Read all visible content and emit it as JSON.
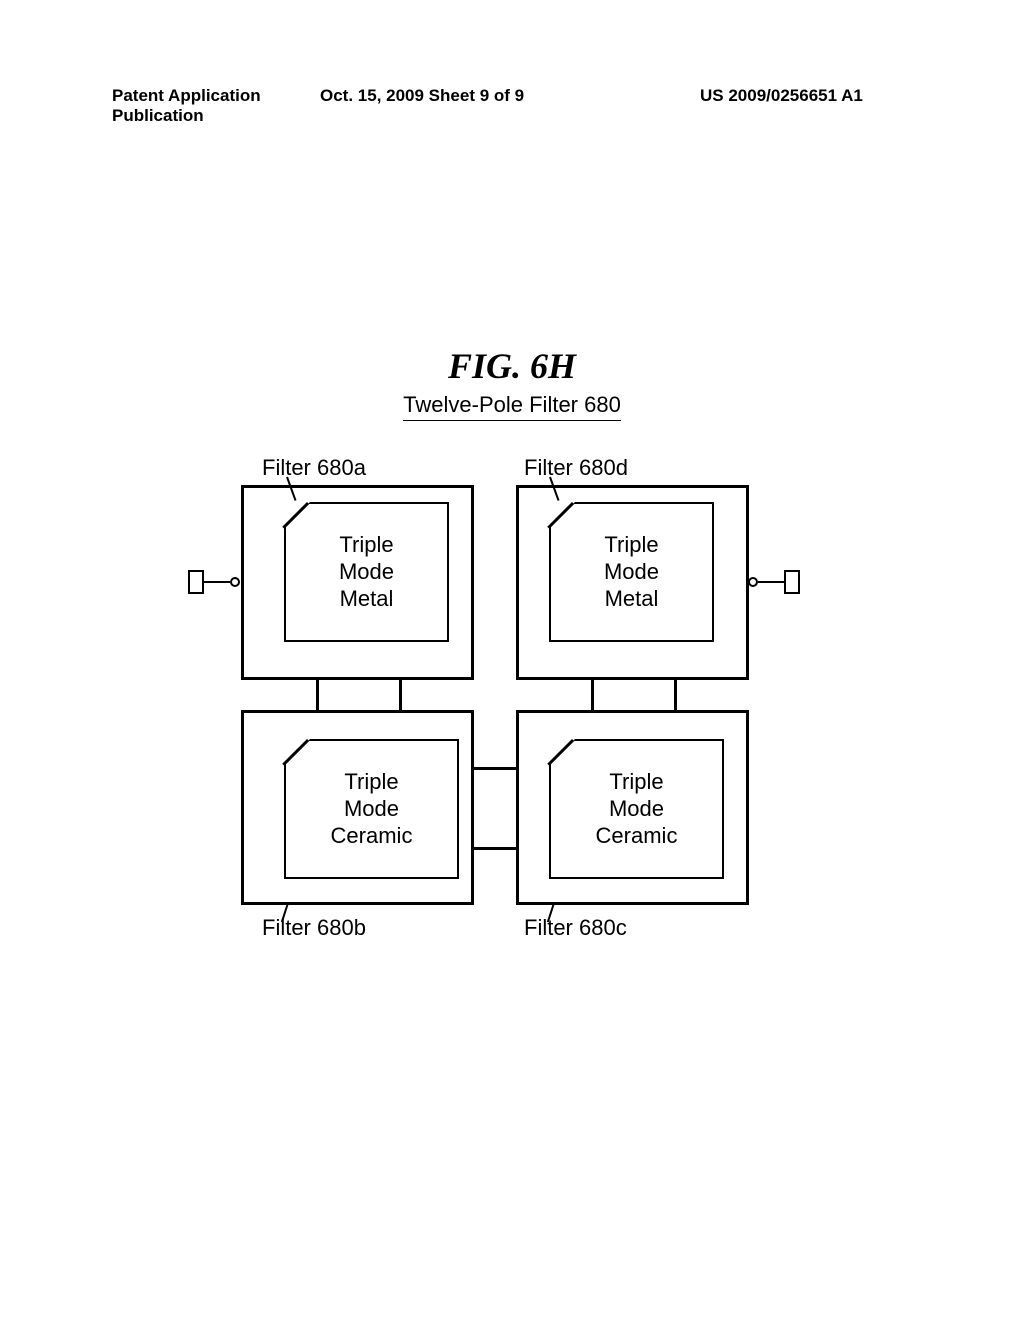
{
  "header": {
    "left": "Patent Application Publication",
    "middle": "Oct. 15, 2009  Sheet 9 of 9",
    "right": "US 2009/0256651 A1"
  },
  "figure_title": "FIG. 6H",
  "subtitle": "Twelve-Pole Filter 680",
  "labels": {
    "a": "Filter 680a",
    "b": "Filter 680b",
    "c": "Filter 680c",
    "d": "Filter 680d"
  },
  "blocks": {
    "a": {
      "line1": "Triple",
      "line2": "Mode",
      "line3": "Metal"
    },
    "b": {
      "line1": "Triple",
      "line2": "Mode",
      "line3": "Ceramic"
    },
    "c": {
      "line1": "Triple",
      "line2": "Mode",
      "line3": "Ceramic"
    },
    "d": {
      "line1": "Triple",
      "line2": "Mode",
      "line3": "Metal"
    }
  }
}
